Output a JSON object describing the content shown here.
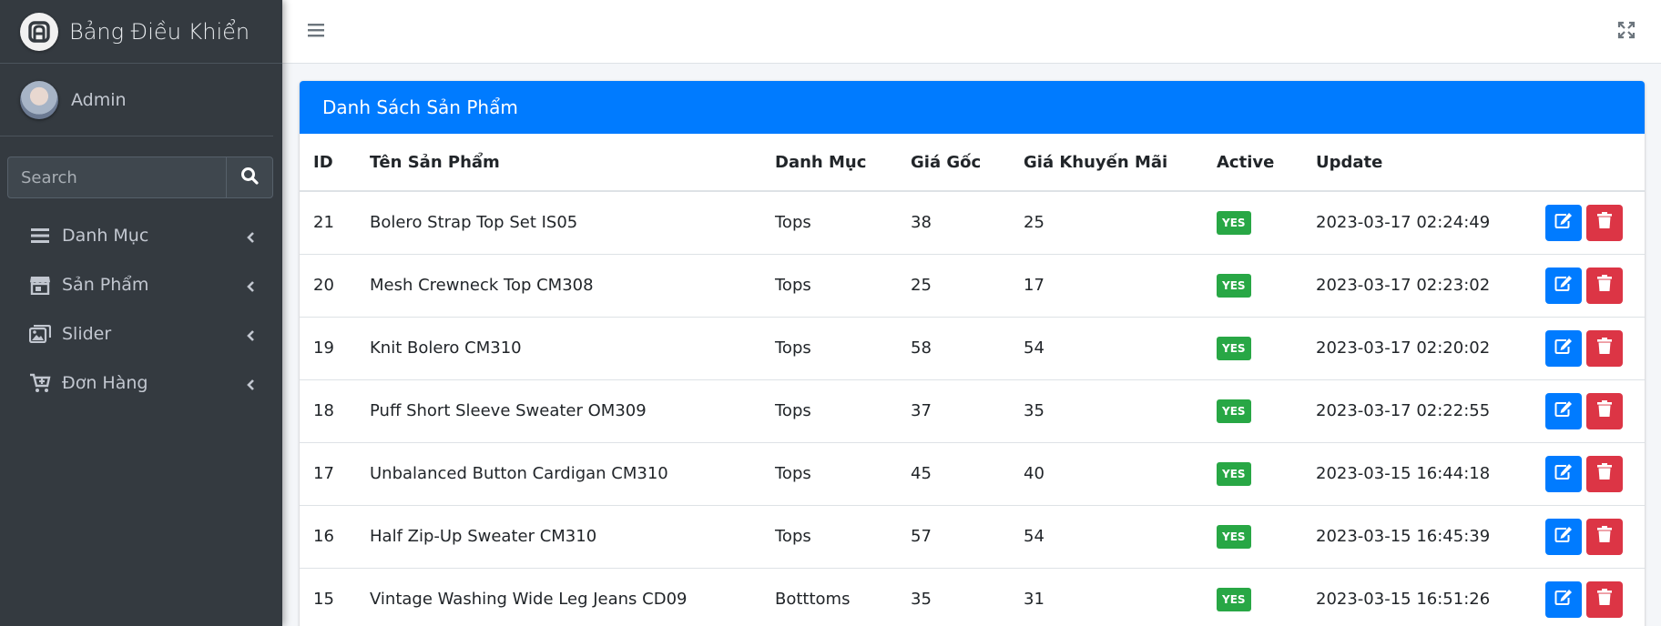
{
  "brand": {
    "title": "Bảng Điều Khiển"
  },
  "user": {
    "name": "Admin"
  },
  "search": {
    "placeholder": "Search"
  },
  "sidebar": {
    "items": [
      {
        "label": "Danh Mục",
        "icon": "list-icon"
      },
      {
        "label": "Sản Phẩm",
        "icon": "store-icon"
      },
      {
        "label": "Slider",
        "icon": "images-icon"
      },
      {
        "label": "Đơn Hàng",
        "icon": "cart-plus-icon"
      }
    ]
  },
  "card": {
    "title": "Danh Sách Sản Phẩm"
  },
  "table": {
    "headers": [
      "ID",
      "Tên Sản Phẩm",
      "Danh Mục",
      "Giá Gốc",
      "Giá Khuyến Mãi",
      "Active",
      "Update"
    ],
    "rows": [
      {
        "id": "21",
        "name": "Bolero Strap Top Set IS05",
        "category": "Tops",
        "price": "38",
        "sale": "25",
        "active": "YES",
        "updated": "2023-03-17 02:24:49"
      },
      {
        "id": "20",
        "name": "Mesh Crewneck Top CM308",
        "category": "Tops",
        "price": "25",
        "sale": "17",
        "active": "YES",
        "updated": "2023-03-17 02:23:02"
      },
      {
        "id": "19",
        "name": "Knit Bolero CM310",
        "category": "Tops",
        "price": "58",
        "sale": "54",
        "active": "YES",
        "updated": "2023-03-17 02:20:02"
      },
      {
        "id": "18",
        "name": "Puff Short Sleeve Sweater OM309",
        "category": "Tops",
        "price": "37",
        "sale": "35",
        "active": "YES",
        "updated": "2023-03-17 02:22:55"
      },
      {
        "id": "17",
        "name": "Unbalanced Button Cardigan CM310",
        "category": "Tops",
        "price": "45",
        "sale": "40",
        "active": "YES",
        "updated": "2023-03-15 16:44:18"
      },
      {
        "id": "16",
        "name": "Half Zip-Up Sweater CM310",
        "category": "Tops",
        "price": "57",
        "sale": "54",
        "active": "YES",
        "updated": "2023-03-15 16:45:39"
      },
      {
        "id": "15",
        "name": "Vintage Washing Wide Leg Jeans CD09",
        "category": "Botttoms",
        "price": "35",
        "sale": "31",
        "active": "YES",
        "updated": "2023-03-15 16:51:26"
      }
    ]
  },
  "colors": {
    "primary": "#007bff",
    "success": "#28a745",
    "danger": "#dc3545",
    "sidebar": "#343a40"
  }
}
